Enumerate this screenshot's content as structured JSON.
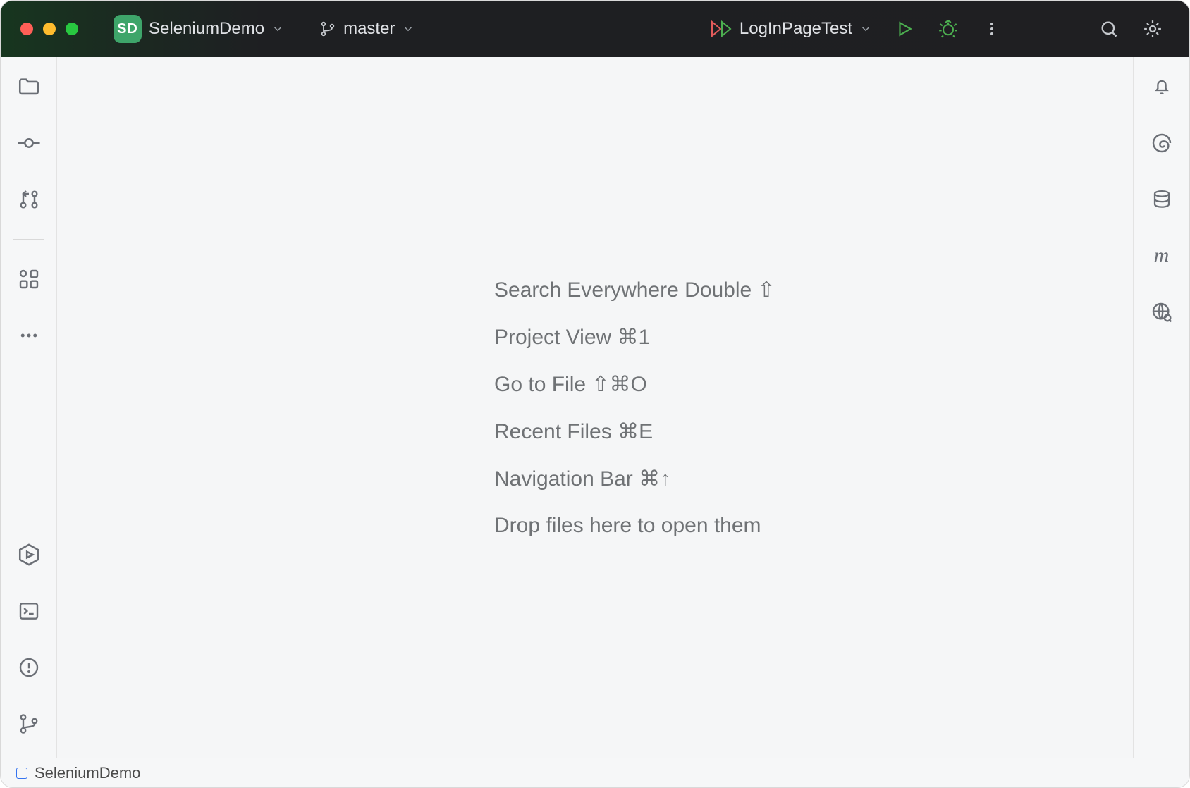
{
  "titlebar": {
    "project_badge": "SD",
    "project_name": "SeleniumDemo",
    "branch_name": "master",
    "run_config": "LogInPageTest"
  },
  "left_sidebar": {
    "folder": "folder-icon",
    "commit": "commit-icon",
    "pull_requests": "pull-requests-icon",
    "structure": "structure-icon",
    "more": "more-icon",
    "services": "services-icon",
    "terminal": "terminal-icon",
    "problems": "problems-icon",
    "git": "git-icon"
  },
  "right_sidebar": {
    "notifications": "bell-icon",
    "ai": "ai-icon",
    "database": "database-icon",
    "maven": "maven-icon",
    "coverage": "coverage-icon"
  },
  "editor_hints": [
    {
      "label": "Search Everywhere",
      "shortcut": "Double ⇧"
    },
    {
      "label": "Project View",
      "shortcut": "⌘1"
    },
    {
      "label": "Go to File",
      "shortcut": "⇧⌘O"
    },
    {
      "label": "Recent Files",
      "shortcut": "⌘E"
    },
    {
      "label": "Navigation Bar",
      "shortcut": "⌘↑"
    },
    {
      "label": "Drop files here to open them",
      "shortcut": ""
    }
  ],
  "statusbar": {
    "module": "SeleniumDemo"
  }
}
